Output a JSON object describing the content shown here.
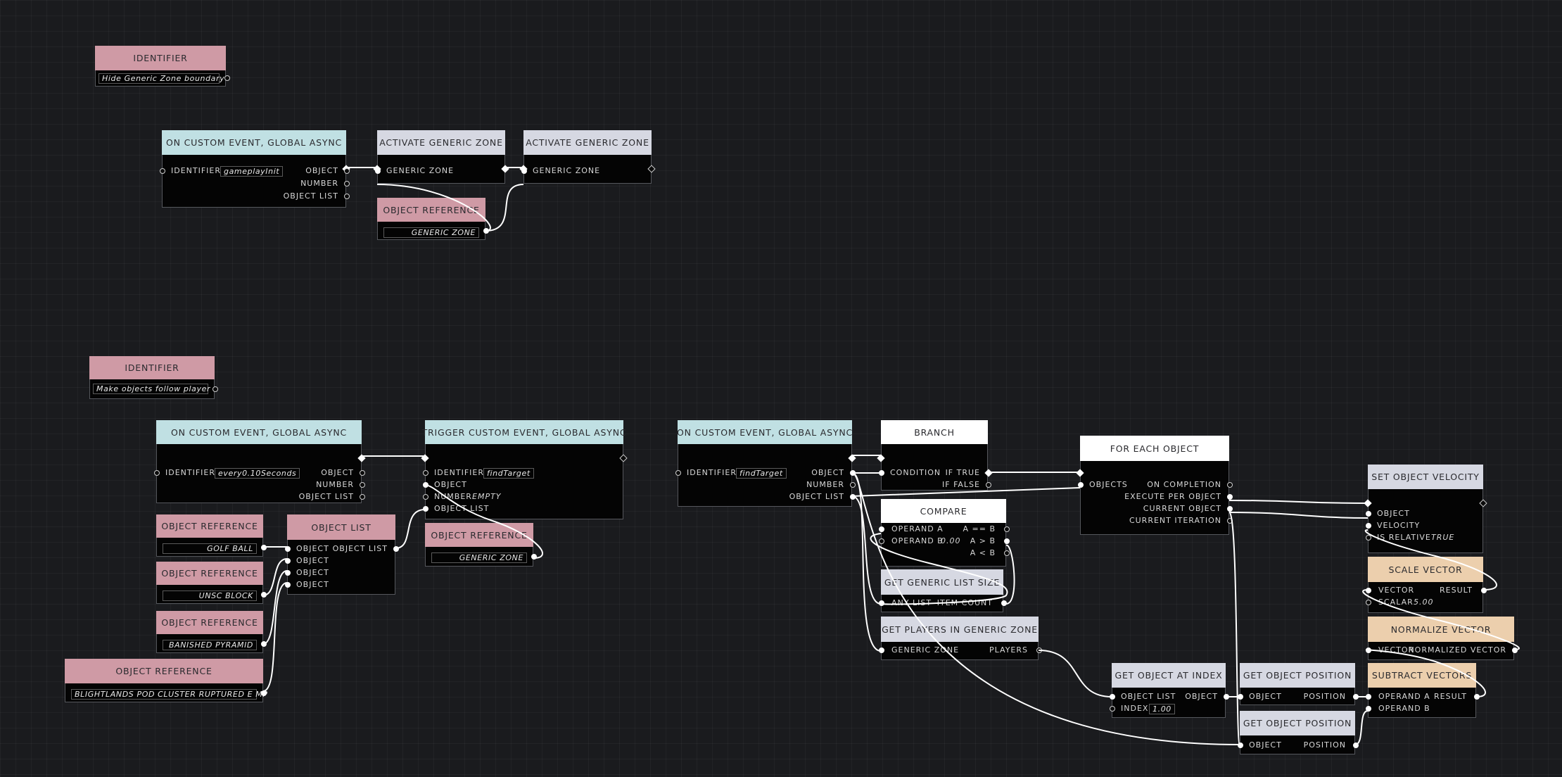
{
  "colors": {
    "canvas_bg": "#1a1b1e",
    "event_header": "#c0e0e3",
    "reference_header": "#cf9aa5",
    "action_header": "#d6d8e2",
    "flow_header": "#ffffff",
    "vector_header": "#eccfad",
    "node_body": "#040404",
    "wire": "#ffffff"
  },
  "nodes": {
    "identifier_1": {
      "title": "IDENTIFIER",
      "value": "Hide Generic Zone boundary"
    },
    "event_1": {
      "title": "ON CUSTOM EVENT, GLOBAL ASYNC",
      "identifier_label": "IDENTIFIER",
      "identifier_value": "gameplayInit",
      "out_object": "OBJECT",
      "out_number": "NUMBER",
      "out_object_list": "OBJECT LIST"
    },
    "activate_zone_1": {
      "title": "ACTIVATE GENERIC ZONE",
      "in_generic_zone": "GENERIC ZONE"
    },
    "activate_zone_2": {
      "title": "ACTIVATE GENERIC ZONE",
      "in_generic_zone": "GENERIC ZONE"
    },
    "objref_zone_1": {
      "title": "OBJECT REFERENCE",
      "value": "GENERIC ZONE"
    },
    "identifier_2": {
      "title": "IDENTIFIER",
      "value": "Make objects follow player"
    },
    "event_2": {
      "title": "ON CUSTOM EVENT, GLOBAL ASYNC",
      "identifier_label": "IDENTIFIER",
      "identifier_value": "every0.10Seconds",
      "out_object": "OBJECT",
      "out_number": "NUMBER",
      "out_object_list": "OBJECT LIST"
    },
    "trigger_event": {
      "title": "TRIGGER CUSTOM EVENT, GLOBAL ASYNC",
      "identifier_label": "IDENTIFIER",
      "identifier_value": "findTarget",
      "in_object": "OBJECT",
      "in_number": "NUMBER",
      "number_value": "EMPTY",
      "in_object_list": "OBJECT LIST"
    },
    "objref_zone_2": {
      "title": "OBJECT REFERENCE",
      "value": "GENERIC ZONE"
    },
    "objref_golf": {
      "title": "OBJECT REFERENCE",
      "value": "GOLF BALL"
    },
    "objref_unsc": {
      "title": "OBJECT REFERENCE",
      "value": "UNSC BLOCK"
    },
    "objref_pyramid": {
      "title": "OBJECT REFERENCE",
      "value": "BANISHED PYRAMID"
    },
    "objref_pod": {
      "title": "OBJECT REFERENCE",
      "value": "BLIGHTLANDS POD CLUSTER RUPTURED E MP"
    },
    "object_list": {
      "title": "OBJECT LIST",
      "in_labels": [
        "OBJECT",
        "OBJECT",
        "OBJECT",
        "OBJECT"
      ],
      "out_object_list": "OBJECT LIST"
    },
    "event_3": {
      "title": "ON CUSTOM EVENT, GLOBAL ASYNC",
      "identifier_label": "IDENTIFIER",
      "identifier_value": "findTarget",
      "out_object": "OBJECT",
      "out_number": "NUMBER",
      "out_object_list": "OBJECT LIST"
    },
    "branch": {
      "title": "BRANCH",
      "in_condition": "CONDITION",
      "out_true": "IF TRUE",
      "out_false": "IF FALSE"
    },
    "compare": {
      "title": "COMPARE",
      "in_operand_a": "OPERAND A",
      "in_operand_b": "OPERAND B",
      "operand_b_value": "0.00",
      "out_eq": "A == B",
      "out_gt": "A > B",
      "out_lt": "A < B"
    },
    "list_size": {
      "title": "GET GENERIC LIST SIZE",
      "in_any_list": "ANY LIST",
      "out_item_count": "ITEM COUNT"
    },
    "players_in_zone": {
      "title": "GET PLAYERS IN GENERIC ZONE",
      "in_generic_zone": "GENERIC ZONE",
      "out_players": "PLAYERS"
    },
    "for_each": {
      "title": "FOR EACH OBJECT",
      "in_objects": "OBJECTS",
      "out_on_completion": "ON COMPLETION",
      "out_execute": "EXECUTE PER OBJECT",
      "out_current_object": "CURRENT OBJECT",
      "out_current_iteration": "CURRENT ITERATION"
    },
    "object_at_index": {
      "title": "GET OBJECT AT INDEX",
      "in_object_list": "OBJECT LIST",
      "in_index": "INDEX",
      "index_value": "1.00",
      "out_object": "OBJECT"
    },
    "get_pos_1": {
      "title": "GET OBJECT POSITION",
      "in_object": "OBJECT",
      "out_position": "POSITION"
    },
    "get_pos_2": {
      "title": "GET OBJECT POSITION",
      "in_object": "OBJECT",
      "out_position": "POSITION"
    },
    "set_velocity": {
      "title": "SET OBJECT VELOCITY",
      "in_object": "OBJECT",
      "in_velocity": "VELOCITY",
      "in_is_relative": "IS RELATIVE",
      "is_relative_value": "TRUE"
    },
    "scale_vector": {
      "title": "SCALE VECTOR",
      "in_vector": "VECTOR",
      "in_scalar": "SCALAR",
      "scalar_value": "5.00",
      "out_result": "RESULT"
    },
    "normalize_vector": {
      "title": "NORMALIZE VECTOR",
      "in_vector": "VECTOR",
      "out_normalized": "NORMALIZED VECTOR"
    },
    "subtract_vectors": {
      "title": "SUBTRACT VECTORS",
      "in_operand_a": "OPERAND A",
      "in_operand_b": "OPERAND B",
      "out_result": "RESULT"
    }
  }
}
